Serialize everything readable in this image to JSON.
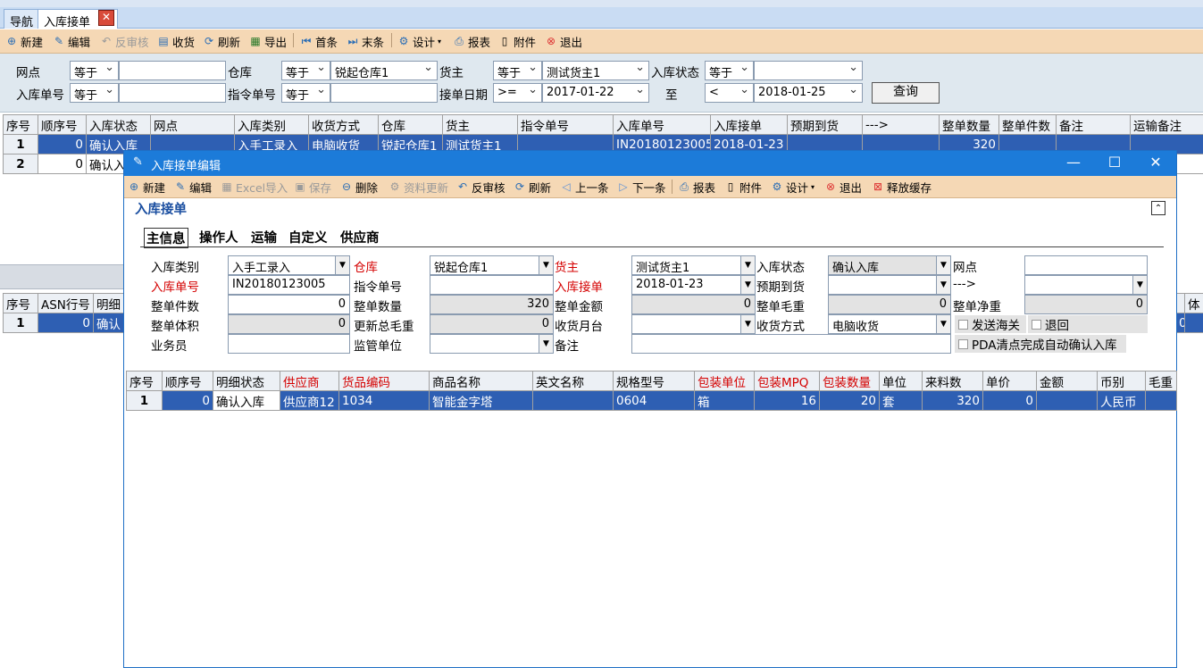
{
  "tabs": {
    "nav": "导航",
    "inbound": "入库接单",
    "close": "✕"
  },
  "toolbar": {
    "new": "新建",
    "edit": "编辑",
    "unaudit": "反审核",
    "receive": "收货",
    "refresh": "刷新",
    "export": "导出",
    "first": "首条",
    "last": "末条",
    "design": "设计",
    "report": "报表",
    "attach": "附件",
    "exit": "退出"
  },
  "filter": {
    "site_label": "网点",
    "site_op": "等于",
    "site_val": "",
    "warehouse_label": "仓库",
    "warehouse_op": "等于",
    "warehouse_val": "锐起仓库1",
    "owner_label": "货主",
    "owner_op": "等于",
    "owner_val": "测试货主1",
    "status_label": "入库状态",
    "status_op": "等于",
    "status_val": "",
    "inno_label": "入库单号",
    "inno_op": "等于",
    "inno_val": "",
    "cmd_label": "指令单号",
    "cmd_op": "等于",
    "cmd_val": "",
    "date_label": "接单日期",
    "date_op": ">=",
    "date_from": "2017-01-22",
    "to_label": "至",
    "date_op2": "<",
    "date_to": "2018-01-25",
    "query": "查询"
  },
  "main_grid": {
    "headers": [
      "序号",
      "顺序号",
      "入库状态",
      "网点",
      "入库类别",
      "收货方式",
      "仓库",
      "货主",
      "指令单号",
      "入库单号",
      "入库接单",
      "预期到货",
      "--->",
      "整单数量",
      "整单件数",
      "备注",
      "运输备注"
    ],
    "rows": [
      {
        "idx": "1",
        "seq": "0",
        "status": "确认入库",
        "site": "",
        "type": "入手工录入",
        "method": "电脑收货",
        "wh": "锐起仓库1",
        "owner": "测试货主1",
        "cmd": "",
        "inno": "IN20180123005",
        "indate": "2018-01-23",
        "exp": "",
        "arrow": "",
        "qty": "320"
      },
      {
        "idx": "2",
        "seq": "0",
        "status": "确认入"
      }
    ]
  },
  "detail_grid": {
    "headers": [
      "序号",
      "ASN行号",
      "明细"
    ],
    "right_header": "体",
    "row": {
      "idx": "1",
      "asn": "0",
      "st": "确认",
      "right": "0"
    }
  },
  "dialog": {
    "title": "入库接单编辑",
    "minimize": "—",
    "maximize": "☐",
    "close": "✕",
    "toolbar": {
      "new": "新建",
      "edit": "编辑",
      "excel": "Excel导入",
      "save": "保存",
      "delete": "删除",
      "update": "资料更新",
      "unaudit": "反审核",
      "refresh": "刷新",
      "prev": "上一条",
      "next": "下一条",
      "report": "报表",
      "attach": "附件",
      "design": "设计",
      "exit": "退出",
      "release": "释放缓存"
    },
    "section_title": "入库接单",
    "collapse": "⌃",
    "subtabs": [
      "主信息",
      "操作人",
      "运输",
      "自定义",
      "供应商"
    ],
    "form": {
      "type_label": "入库类别",
      "type_val": "入手工录入",
      "wh_label": "仓库",
      "wh_val": "锐起仓库1",
      "owner_label": "货主",
      "owner_val": "测试货主1",
      "status_label": "入库状态",
      "status_val": "确认入库",
      "site_label": "网点",
      "site_val": "",
      "inno_label": "入库单号",
      "inno_val": "IN20180123005",
      "cmd_label": "指令单号",
      "cmd_val": "",
      "indate_label": "入库接单",
      "indate_val": "2018-01-23",
      "exp_label": "预期到货",
      "exp_val": "",
      "arrow_label": "--->",
      "arrow_val": "",
      "pcs_label": "整单件数",
      "pcs_val": "0",
      "qty_label": "整单数量",
      "qty_val": "320",
      "amt_label": "整单金额",
      "amt_val": "0",
      "gw_label": "整单毛重",
      "gw_val": "0",
      "nw_label": "整单净重",
      "nw_val": "0",
      "vol_label": "整单体积",
      "vol_val": "0",
      "upd_label": "更新总毛重",
      "upd_val": "0",
      "month_label": "收货月台",
      "month_val": "",
      "method_label": "收货方式",
      "method_val": "电脑收货",
      "customs_label": "发送海关",
      "return_label": "退回",
      "staff_label": "业务员",
      "staff_val": "",
      "super_label": "监管单位",
      "super_val": "",
      "remark_label": "备注",
      "remark_val": "",
      "pda_label": "PDA清点完成自动确认入库"
    },
    "grid": {
      "headers": [
        "序号",
        "顺序号",
        "明细状态",
        "供应商",
        "货品编码",
        "商品名称",
        "英文名称",
        "规格型号",
        "包装单位",
        "包装MPQ",
        "包装数量",
        "单位",
        "来料数",
        "单价",
        "金额",
        "币别",
        "毛重"
      ],
      "row": {
        "idx": "1",
        "seq": "0",
        "st": "确认入库",
        "sup": "供应商12",
        "code": "1034",
        "name": "智能金字塔",
        "en": "",
        "spec": "0604",
        "unit": "箱",
        "mpq": "16",
        "pq": "20",
        "u": "套",
        "in": "320",
        "price": "0",
        "amt": "",
        "cur": "人民币",
        "gw": ""
      }
    }
  }
}
